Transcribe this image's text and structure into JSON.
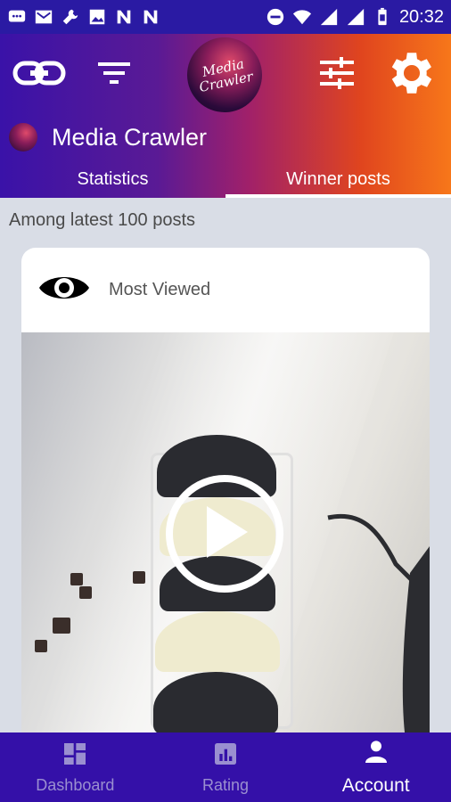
{
  "status_bar": {
    "time": "20:32",
    "icons": [
      "message-icon",
      "mail-icon",
      "wrench-icon",
      "image-icon",
      "n-icon",
      "n-icon",
      "dnd-icon",
      "wifi-icon",
      "signal-icon",
      "signal-icon",
      "battery-icon"
    ]
  },
  "toolbar": {
    "link_icon": "link-icon",
    "filter_icon": "filter-icon",
    "logo_line1": "Media",
    "logo_line2": "Crawler",
    "tune_icon": "tune-icon",
    "settings_icon": "gear-icon"
  },
  "header": {
    "title": "Media Crawler"
  },
  "tabs": [
    {
      "label": "Statistics",
      "active": false
    },
    {
      "label": "Winner posts",
      "active": true
    }
  ],
  "content": {
    "section_label": "Among latest 100 posts",
    "card": {
      "icon": "eye-icon",
      "label": "Most Viewed",
      "media_action": "play-icon"
    }
  },
  "bottom_nav": [
    {
      "label": "Dashboard",
      "icon": "dashboard-icon",
      "active": false
    },
    {
      "label": "Rating",
      "icon": "rating-icon",
      "active": false
    },
    {
      "label": "Account",
      "icon": "account-icon",
      "active": true
    }
  ],
  "colors": {
    "primary": "#3410a8",
    "gradient_end": "#f7771a"
  }
}
